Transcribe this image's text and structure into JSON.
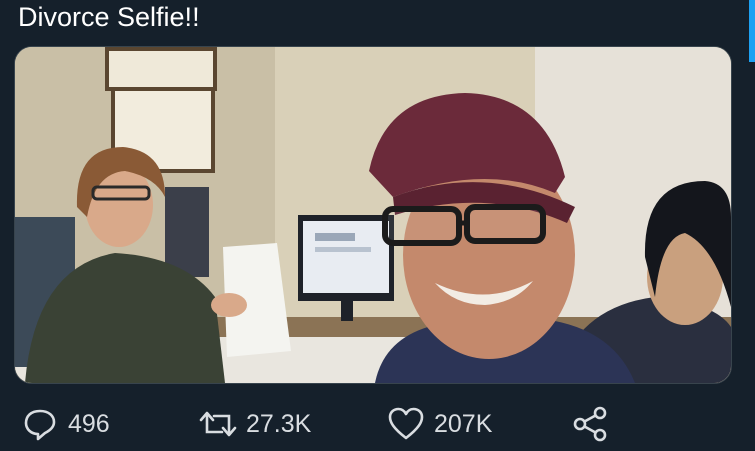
{
  "tweet": {
    "text": "Divorce Selfie!!",
    "accent_color": "#1da1f2",
    "background_color": "#15202b"
  },
  "media": {
    "type": "photo"
  },
  "actions": {
    "reply": {
      "icon": "reply-icon",
      "count": "496"
    },
    "retweet": {
      "icon": "retweet-icon",
      "count": "27.3K"
    },
    "like": {
      "icon": "heart-icon",
      "count": "207K"
    },
    "share": {
      "icon": "share-icon"
    }
  }
}
